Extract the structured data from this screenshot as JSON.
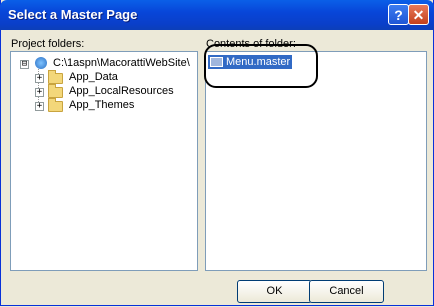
{
  "window": {
    "title": "Select a Master Page",
    "help_label": "?",
    "close_label": "✕"
  },
  "project_folders": {
    "label": "Project folders:",
    "root": {
      "label": "C:\\1aspn\\MacorattiWebSite\\",
      "expander": "⊟"
    },
    "items": [
      {
        "label": "App_Data",
        "expander": "+"
      },
      {
        "label": "App_LocalResources",
        "expander": "+"
      },
      {
        "label": "App_Themes",
        "expander": "+"
      }
    ]
  },
  "contents": {
    "label": "Contents of folder:",
    "files": [
      {
        "label": "Menu.master",
        "selected": true
      }
    ]
  },
  "buttons": {
    "ok_label": "OK",
    "cancel_label": "Cancel"
  },
  "colors": {
    "titlebar": "#0846d9",
    "selection": "#316ac5",
    "dialog_bg": "#ece9d8"
  }
}
